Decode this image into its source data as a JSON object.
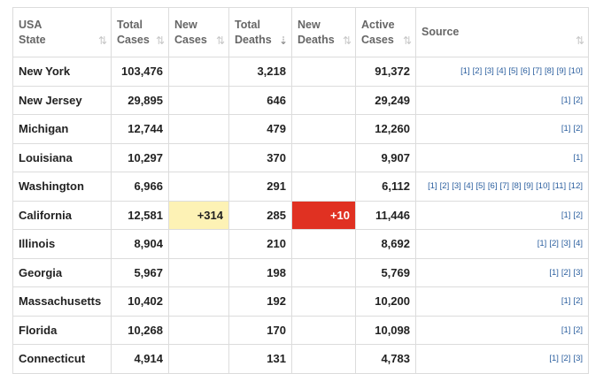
{
  "headers": [
    {
      "line1": "USA",
      "line2": "State",
      "sort": "⇅"
    },
    {
      "line1": "Total",
      "line2": "Cases",
      "sort": "⇅"
    },
    {
      "line1": "New",
      "line2": "Cases",
      "sort": "⇅"
    },
    {
      "line1": "Total",
      "line2": "Deaths",
      "sort": "⇣"
    },
    {
      "line1": "New",
      "line2": "Deaths",
      "sort": "⇅"
    },
    {
      "line1": "Active",
      "line2": "Cases",
      "sort": "⇅"
    },
    {
      "line1": "",
      "line2": "Source",
      "sort": "⇅"
    }
  ],
  "rows": [
    {
      "state": "New York",
      "total_cases": "103,476",
      "new_cases": "",
      "total_deaths": "3,218",
      "new_deaths": "",
      "active_cases": "91,372",
      "sources": [
        "[1]",
        "[2]",
        "[3]",
        "[4]",
        "[5]",
        "[6]",
        "[7]",
        "[8]",
        "[9]",
        "[10]"
      ]
    },
    {
      "state": "New Jersey",
      "total_cases": "29,895",
      "new_cases": "",
      "total_deaths": "646",
      "new_deaths": "",
      "active_cases": "29,249",
      "sources": [
        "[1]",
        "[2]"
      ]
    },
    {
      "state": "Michigan",
      "total_cases": "12,744",
      "new_cases": "",
      "total_deaths": "479",
      "new_deaths": "",
      "active_cases": "12,260",
      "sources": [
        "[1]",
        "[2]"
      ]
    },
    {
      "state": "Louisiana",
      "total_cases": "10,297",
      "new_cases": "",
      "total_deaths": "370",
      "new_deaths": "",
      "active_cases": "9,907",
      "sources": [
        "[1]"
      ]
    },
    {
      "state": "Washington",
      "total_cases": "6,966",
      "new_cases": "",
      "total_deaths": "291",
      "new_deaths": "",
      "active_cases": "6,112",
      "sources": [
        "[1]",
        "[2]",
        "[3]",
        "[4]",
        "[5]",
        "[6]",
        "[7]",
        "[8]",
        "[9]",
        "[10]",
        "[11]",
        "[12]"
      ]
    },
    {
      "state": "California",
      "total_cases": "12,581",
      "new_cases": "+314",
      "total_deaths": "285",
      "new_deaths": "+10",
      "active_cases": "11,446",
      "sources": [
        "[1]",
        "[2]"
      ]
    },
    {
      "state": "Illinois",
      "total_cases": "8,904",
      "new_cases": "",
      "total_deaths": "210",
      "new_deaths": "",
      "active_cases": "8,692",
      "sources": [
        "[1]",
        "[2]",
        "[3]",
        "[4]"
      ]
    },
    {
      "state": "Georgia",
      "total_cases": "5,967",
      "new_cases": "",
      "total_deaths": "198",
      "new_deaths": "",
      "active_cases": "5,769",
      "sources": [
        "[1]",
        "[2]",
        "[3]"
      ]
    },
    {
      "state": "Massachusetts",
      "total_cases": "10,402",
      "new_cases": "",
      "total_deaths": "192",
      "new_deaths": "",
      "active_cases": "10,200",
      "sources": [
        "[1]",
        "[2]"
      ]
    },
    {
      "state": "Florida",
      "total_cases": "10,268",
      "new_cases": "",
      "total_deaths": "170",
      "new_deaths": "",
      "active_cases": "10,098",
      "sources": [
        "[1]",
        "[2]"
      ]
    },
    {
      "state": "Connecticut",
      "total_cases": "4,914",
      "new_cases": "",
      "total_deaths": "131",
      "new_deaths": "",
      "active_cases": "4,783",
      "sources": [
        "[1]",
        "[2]",
        "[3]"
      ]
    }
  ],
  "colors": {
    "new_cases_highlight": "#fdf2b5",
    "new_deaths_highlight": "#e03122",
    "source_link": "#2a5e9e"
  }
}
